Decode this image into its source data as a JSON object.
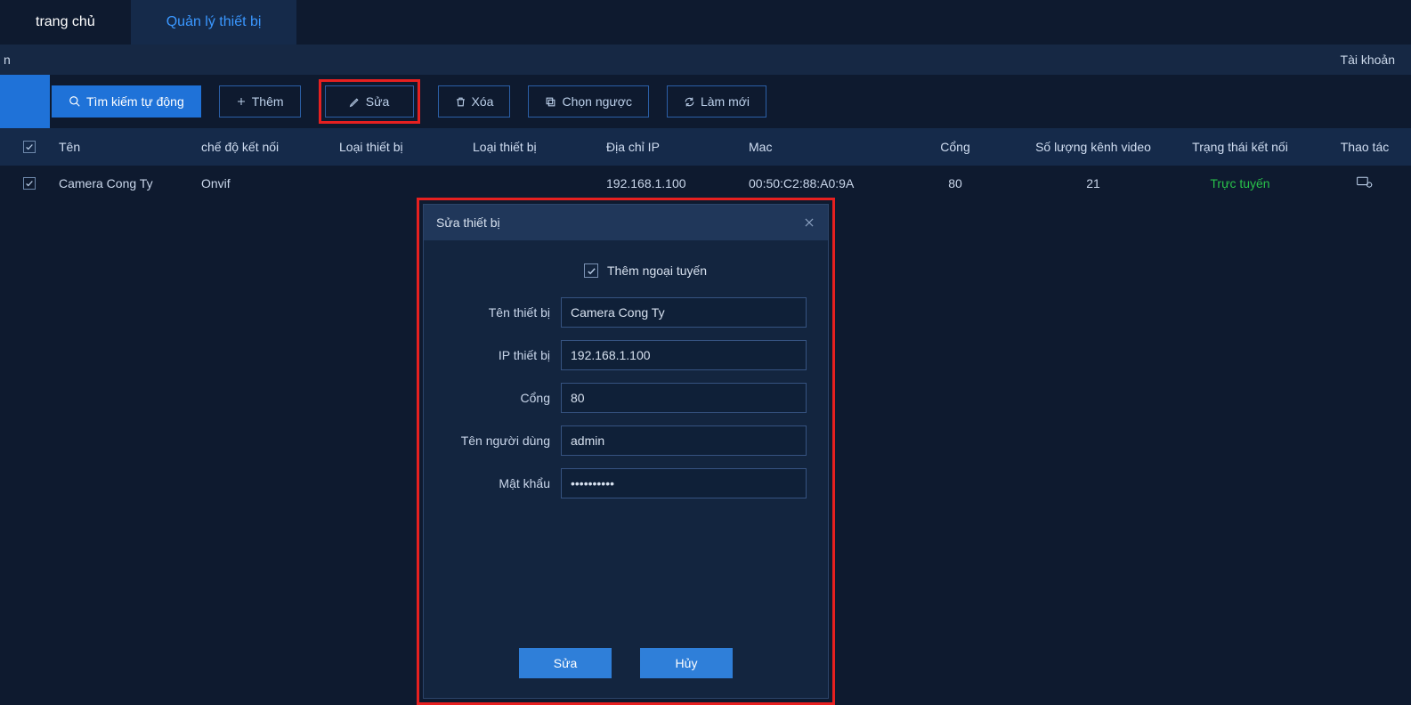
{
  "tabs": {
    "home": "trang chủ",
    "device": "Quản lý thiết bị"
  },
  "subbar": {
    "left": "n",
    "account": "Tài khoản"
  },
  "toolbar": {
    "auto_search": "Tìm kiếm tự động",
    "add": "Thêm",
    "edit": "Sửa",
    "delete": "Xóa",
    "invert": "Chọn ngược",
    "refresh": "Làm mới"
  },
  "columns": {
    "name": "Tên",
    "conn_mode": "chế độ kết nối",
    "dev_type1": "Loại thiết bị",
    "dev_type2": "Loại thiết bị",
    "ip": "Địa chỉ IP",
    "mac": "Mac",
    "port": "Cổng",
    "channels": "Số lượng kênh video",
    "status": "Trạng thái kết nối",
    "action": "Thao tác"
  },
  "rows": [
    {
      "name": "Camera Cong Ty",
      "conn_mode": "Onvif",
      "dev_type1": "",
      "dev_type2": "",
      "ip": "192.168.1.100",
      "mac": "00:50:C2:88:A0:9A",
      "port": "80",
      "channels": "21",
      "status": "Trực tuyến"
    }
  ],
  "modal": {
    "title": "Sửa thiết bị",
    "offline": "Thêm ngoại tuyến",
    "labels": {
      "name": "Tên thiết bị",
      "ip": "IP thiết bị",
      "port": "Cổng",
      "user": "Tên người dùng",
      "pass": "Mật khẩu"
    },
    "values": {
      "name": "Camera Cong Ty",
      "ip": "192.168.1.100",
      "port": "80",
      "user": "admin",
      "pass": "••••••••••"
    },
    "buttons": {
      "ok": "Sửa",
      "cancel": "Hủy"
    }
  }
}
